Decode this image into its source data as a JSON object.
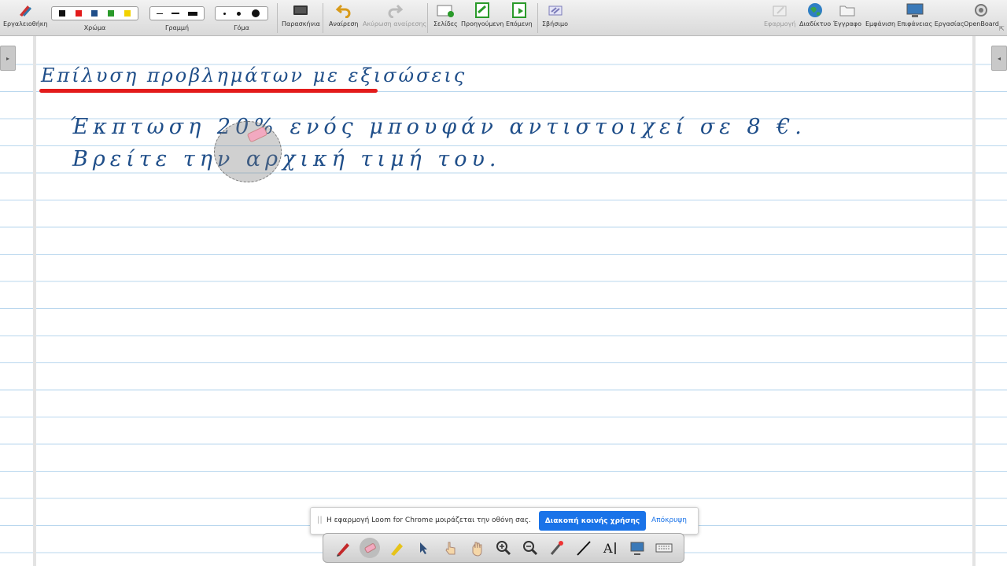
{
  "toolbar": {
    "toolbox_label": "Εργαλειοθήκη",
    "color_label": "Χρώμα",
    "line_label": "Γραμμή",
    "thickness_label": "Γόμα",
    "background_label": "Παρασκήνια",
    "undo_label": "Αναίρεση",
    "redo_label": "Ακύρωση αναίρεσης",
    "pages_label": "Σελίδες",
    "previous_label": "Προηγούμενη",
    "next_label": "Επόμενη",
    "erase_label": "Σβήσιμο",
    "app_label": "Εφαρμογή",
    "web_label": "Διαδίκτυο",
    "document_label": "Έγγραφο",
    "desktop_label": "Εμφάνιση Επιφάνειας Εργασίας",
    "openboard_label": "OpenBoard",
    "colors": [
      "#111111",
      "#e31b1b",
      "#1f4e89",
      "#2a9a2a",
      "#f2d200"
    ]
  },
  "board": {
    "title": "Επίλυση προβλημάτων με εξισώσεις",
    "line1": "Έκπτωση 20% ενός μπουφάν αντιστοιχεί σε 8 €.",
    "line2": "Βρείτε την αρχική τιμή του."
  },
  "loom_bar": {
    "message": "Η εφαρμογή Loom for Chrome μοιράζεται την οθόνη σας.",
    "stop_button": "Διακοπή κοινής χρήσης",
    "hide_link": "Απόκρυψη"
  },
  "bottom_tools": [
    "pen-icon",
    "eraser-icon",
    "marker-icon",
    "selector-icon",
    "pointer-hand-icon",
    "hand-icon",
    "zoom-in-icon",
    "zoom-out-icon",
    "laser-pointer-icon",
    "line-icon",
    "text-icon",
    "capture-icon",
    "keyboard-icon"
  ]
}
